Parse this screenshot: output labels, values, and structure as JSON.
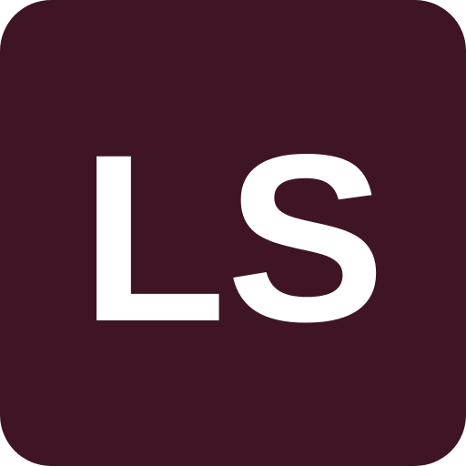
{
  "app_icon": {
    "monogram": "LS",
    "background_color": "#3f1526",
    "text_color": "#ffffff"
  }
}
